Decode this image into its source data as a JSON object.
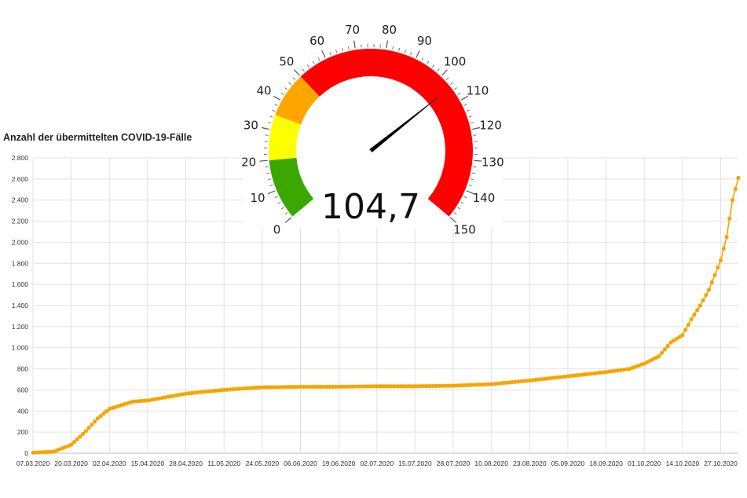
{
  "chart_data": [
    {
      "type": "line",
      "title": "Anzahl der übermittelten COVID-19-Fälle",
      "xlabel": "",
      "ylabel": "",
      "ylim": [
        0,
        2800
      ],
      "grid": true,
      "legend": "none",
      "line_color": "#f7a500",
      "y_ticks": [
        "0",
        "200",
        "400",
        "600",
        "800",
        "1.000",
        "1.200",
        "1.400",
        "1.600",
        "1.800",
        "2.000",
        "2.200",
        "2.400",
        "2.600",
        "2.800"
      ],
      "x_ticks": [
        "07.03.2020",
        "20.03.2020",
        "02.04.2020",
        "15.04.2020",
        "28.04.2020",
        "11.05.2020",
        "24.05.2020",
        "06.06.2020",
        "19.06.2020",
        "02.07.2020",
        "15.07.2020",
        "28.07.2020",
        "10.08.2020",
        "23.08.2020",
        "05.09.2020",
        "18.09.2020",
        "01.10.2020",
        "14.10.2020",
        "27.10.2020"
      ],
      "series": [
        {
          "x": [
            "07.03.2020",
            "14.03.2020",
            "20.03.2020",
            "25.03.2020",
            "29.03.2020",
            "02.04.2020",
            "06.04.2020",
            "10.04.2020",
            "15.04.2020",
            "22.04.2020",
            "28.04.2020",
            "05.05.2020",
            "11.05.2020",
            "18.05.2020",
            "24.05.2020",
            "06.06.2020",
            "19.06.2020",
            "02.07.2020",
            "15.07.2020",
            "28.07.2020",
            "10.08.2020",
            "23.08.2020",
            "05.09.2020",
            "18.09.2020",
            "26.09.2020",
            "01.10.2020",
            "06.10.2020",
            "10.10.2020",
            "14.10.2020",
            "17.10.2020",
            "20.10.2020",
            "23.10.2020",
            "25.10.2020",
            "27.10.2020",
            "29.10.2020",
            "31.10.2020",
            "02.11.2020"
          ],
          "values": [
            5,
            15,
            80,
            210,
            330,
            420,
            455,
            490,
            500,
            535,
            565,
            585,
            600,
            615,
            625,
            630,
            630,
            635,
            635,
            640,
            655,
            690,
            730,
            770,
            800,
            850,
            920,
            1050,
            1120,
            1270,
            1400,
            1550,
            1690,
            1830,
            2050,
            2400,
            2610
          ]
        }
      ]
    },
    {
      "type": "gauge",
      "value": 104.7,
      "value_label": "104,7",
      "min": 0,
      "max": 150,
      "tick_labels": [
        "0",
        "10",
        "20",
        "30",
        "40",
        "50",
        "60",
        "70",
        "80",
        "90",
        "100",
        "110",
        "120",
        "130",
        "140",
        "150"
      ],
      "bands": [
        {
          "from": 0,
          "to": 20,
          "color": "#3aa800"
        },
        {
          "from": 20,
          "to": 35,
          "color": "#ffff00"
        },
        {
          "from": 35,
          "to": 50,
          "color": "#ffa500"
        },
        {
          "from": 50,
          "to": 150,
          "color": "#ff0000"
        }
      ],
      "needle_color": "#000000"
    }
  ]
}
